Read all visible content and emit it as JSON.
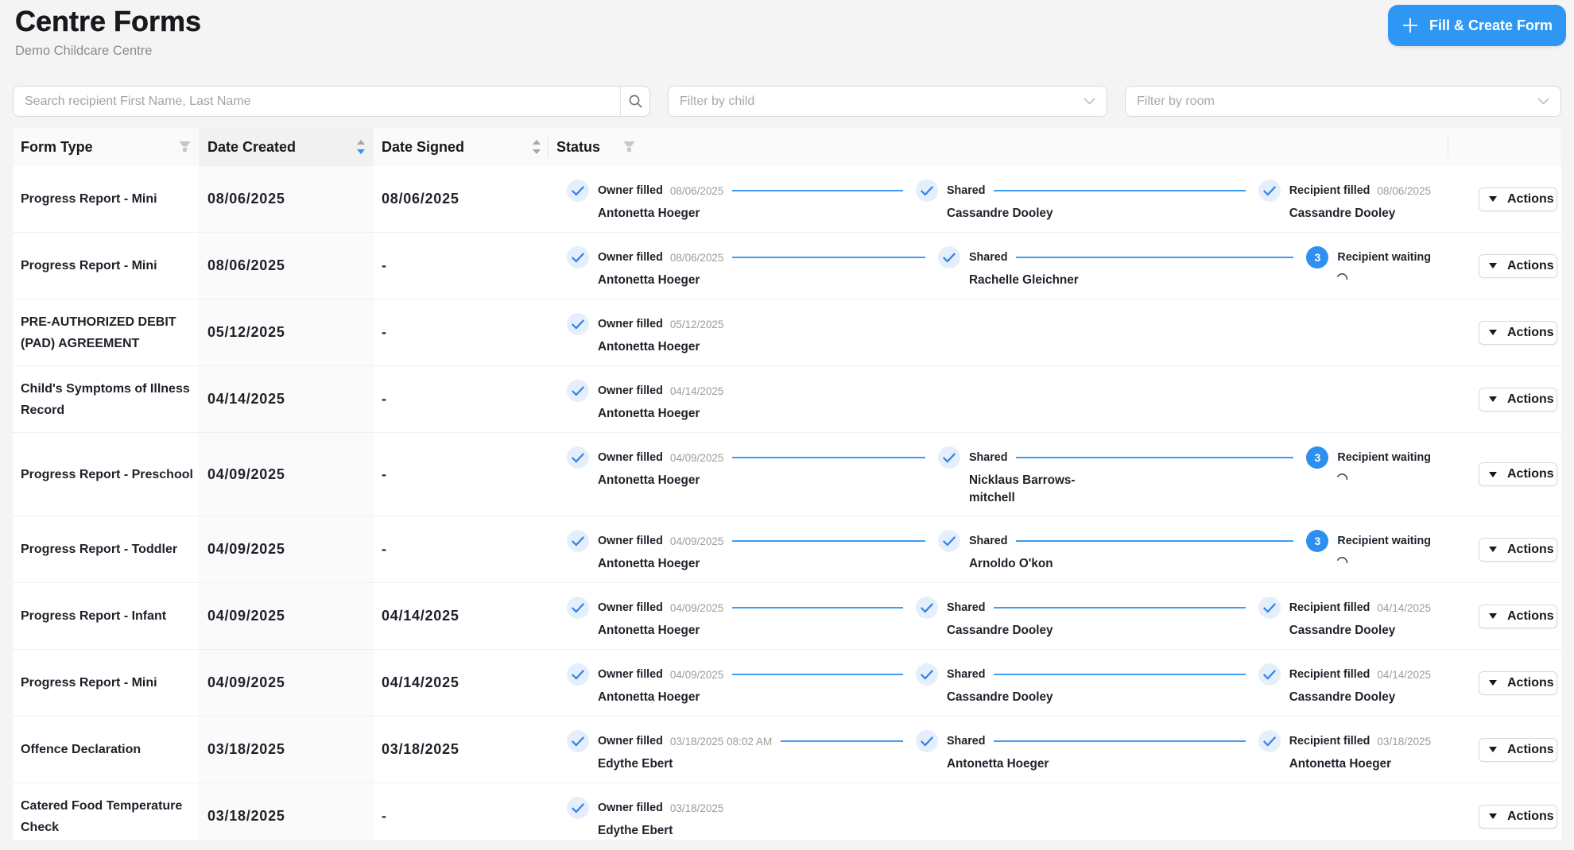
{
  "header": {
    "title": "Centre Forms",
    "subtitle": "Demo Childcare Centre",
    "create_button_label": "Fill & Create Form"
  },
  "filters": {
    "search_placeholder": "Search recipient First Name, Last Name",
    "child_filter_placeholder": "Filter by child",
    "room_filter_placeholder": "Filter by room"
  },
  "table": {
    "columns": [
      {
        "label": "Form Type",
        "icon": "filter-icon"
      },
      {
        "label": "Date Created",
        "icon": "sorter-icon",
        "sort": "descend",
        "highlighted": true
      },
      {
        "label": "Date Signed",
        "icon": "sorter-icon"
      },
      {
        "label": "Status",
        "icon": "filter-icon"
      },
      {
        "label": ""
      }
    ],
    "actions_label": "Actions",
    "rows": [
      {
        "form_type": "Progress Report - Mini",
        "date_created": "08/06/2025",
        "date_signed": "08/06/2025",
        "steps": [
          {
            "icon": "check",
            "label": "Owner filled",
            "date": "08/06/2025",
            "name": "Antonetta Hoeger"
          },
          {
            "icon": "check",
            "label": "Shared",
            "name": "Cassandre Dooley"
          },
          {
            "icon": "check",
            "label": "Recipient filled",
            "date": "08/06/2025",
            "name": "Cassandre Dooley"
          }
        ]
      },
      {
        "form_type": "Progress Report - Mini",
        "date_created": "08/06/2025",
        "date_signed": "-",
        "steps": [
          {
            "icon": "check",
            "label": "Owner filled",
            "date": "08/06/2025",
            "name": "Antonetta Hoeger"
          },
          {
            "icon": "check",
            "label": "Shared",
            "name": "Rachelle Gleichner"
          },
          {
            "icon": "number",
            "number": "3",
            "label": "Recipient waiting",
            "spinner": true
          }
        ]
      },
      {
        "form_type": "PRE-AUTHORIZED DEBIT (PAD) AGREEMENT",
        "date_created": "05/12/2025",
        "date_signed": "-",
        "steps": [
          {
            "icon": "check",
            "label": "Owner filled",
            "date": "05/12/2025",
            "name": "Antonetta Hoeger"
          }
        ]
      },
      {
        "form_type": "Child's Symptoms of Illness Record",
        "date_created": "04/14/2025",
        "date_signed": "-",
        "steps": [
          {
            "icon": "check",
            "label": "Owner filled",
            "date": "04/14/2025",
            "name": "Antonetta Hoeger"
          }
        ]
      },
      {
        "form_type": "Progress Report - Preschool",
        "date_created": "04/09/2025",
        "date_signed": "-",
        "steps": [
          {
            "icon": "check",
            "label": "Owner filled",
            "date": "04/09/2025",
            "name": "Antonetta Hoeger"
          },
          {
            "icon": "check",
            "label": "Shared",
            "name": "Nicklaus Barrows-mitchell"
          },
          {
            "icon": "number",
            "number": "3",
            "label": "Recipient waiting",
            "spinner": true
          }
        ]
      },
      {
        "form_type": "Progress Report - Toddler",
        "date_created": "04/09/2025",
        "date_signed": "-",
        "steps": [
          {
            "icon": "check",
            "label": "Owner filled",
            "date": "04/09/2025",
            "name": "Antonetta Hoeger"
          },
          {
            "icon": "check",
            "label": "Shared",
            "name": "Arnoldo O'kon"
          },
          {
            "icon": "number",
            "number": "3",
            "label": "Recipient waiting",
            "spinner": true
          }
        ]
      },
      {
        "form_type": "Progress Report - Infant",
        "date_created": "04/09/2025",
        "date_signed": "04/14/2025",
        "steps": [
          {
            "icon": "check",
            "label": "Owner filled",
            "date": "04/09/2025",
            "name": "Antonetta Hoeger"
          },
          {
            "icon": "check",
            "label": "Shared",
            "name": "Cassandre Dooley"
          },
          {
            "icon": "check",
            "label": "Recipient filled",
            "date": "04/14/2025",
            "name": "Cassandre Dooley"
          }
        ]
      },
      {
        "form_type": "Progress Report - Mini",
        "date_created": "04/09/2025",
        "date_signed": "04/14/2025",
        "steps": [
          {
            "icon": "check",
            "label": "Owner filled",
            "date": "04/09/2025",
            "name": "Antonetta Hoeger"
          },
          {
            "icon": "check",
            "label": "Shared",
            "name": "Cassandre Dooley"
          },
          {
            "icon": "check",
            "label": "Recipient filled",
            "date": "04/14/2025",
            "name": "Cassandre Dooley"
          }
        ]
      },
      {
        "form_type": "Offence Declaration",
        "date_created": "03/18/2025",
        "date_signed": "03/18/2025",
        "steps": [
          {
            "icon": "check",
            "label": "Owner filled",
            "date": "03/18/2025 08:02 AM",
            "name": "Edythe Ebert"
          },
          {
            "icon": "check",
            "label": "Shared",
            "name": "Antonetta Hoeger"
          },
          {
            "icon": "check",
            "label": "Recipient filled",
            "date": "03/18/2025",
            "name": "Antonetta Hoeger"
          }
        ]
      },
      {
        "form_type": "Catered Food Temperature Check",
        "date_created": "03/18/2025",
        "date_signed": "-",
        "steps": [
          {
            "icon": "check",
            "label": "Owner filled",
            "date": "03/18/2025",
            "name": "Edythe Ebert"
          }
        ]
      }
    ]
  },
  "colors": {
    "brand_blue": "#2e96f3",
    "check_blue": "#2e86ef",
    "check_circle_bg": "#e4effc",
    "number_circle_bg": "#2d8ff0",
    "connector_blue": "#3d9bf3",
    "page_bg": "#f4f4f4",
    "header_bg": "#fafafa",
    "sorted_header_bg": "#f1f1f1",
    "sorted_col_bg": "#fafafa",
    "row_border": "#f0f0f0"
  }
}
